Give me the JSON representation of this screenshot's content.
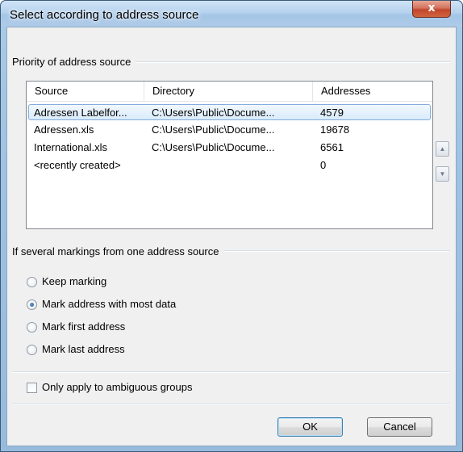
{
  "window": {
    "title": "Select according to address source",
    "close_glyph": "x"
  },
  "source_group": {
    "caption": "Priority of address source",
    "columns": [
      "Source",
      "Directory",
      "Addresses"
    ],
    "rows": [
      {
        "source": "Adressen Labelfor...",
        "directory": "C:\\Users\\Public\\Docume...",
        "addresses": "4579",
        "selected": true
      },
      {
        "source": "Adressen.xls",
        "directory": "C:\\Users\\Public\\Docume...",
        "addresses": "19678",
        "selected": false
      },
      {
        "source": "International.xls",
        "directory": "C:\\Users\\Public\\Docume...",
        "addresses": "6561",
        "selected": false
      },
      {
        "source": "<recently created>",
        "directory": "",
        "addresses": "0",
        "selected": false
      }
    ],
    "move_up_glyph": "▲",
    "move_down_glyph": "▼"
  },
  "marking_group": {
    "caption": "If several markings from one address source",
    "options": [
      {
        "label": "Keep marking",
        "checked": false
      },
      {
        "label": "Mark address with most data",
        "checked": true
      },
      {
        "label": "Mark first address",
        "checked": false
      },
      {
        "label": "Mark last address",
        "checked": false
      }
    ]
  },
  "ambiguous": {
    "label": "Only apply to ambiguous groups",
    "checked": false
  },
  "buttons": {
    "ok": "OK",
    "cancel": "Cancel"
  },
  "colors": {
    "selection": "#d9ebfb",
    "selection_border": "#84acdd",
    "close_button": "#c2452b"
  }
}
